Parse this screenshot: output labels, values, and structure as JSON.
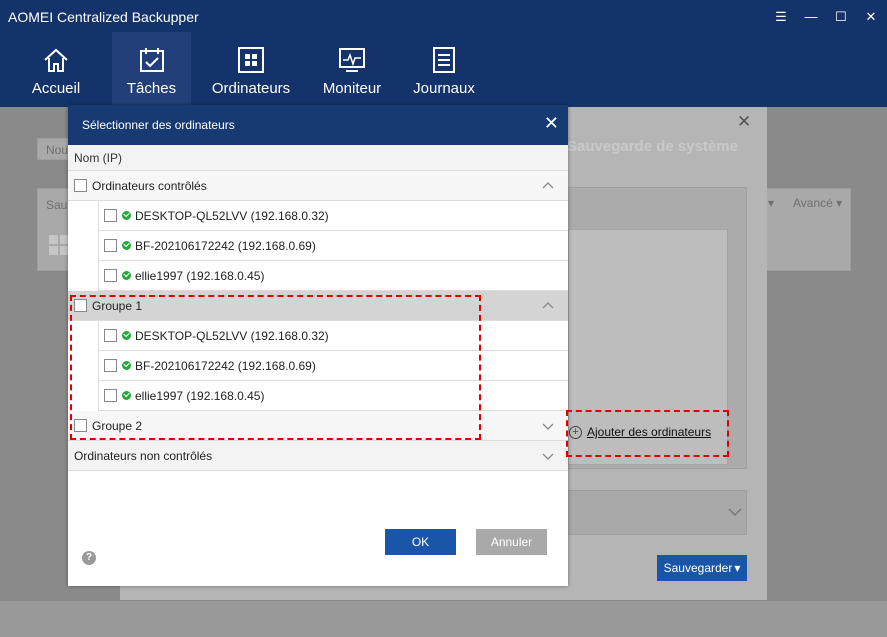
{
  "app": {
    "title": "AOMEI Centralized Backupper"
  },
  "nav": [
    {
      "label": "Accueil",
      "icon": "home-icon"
    },
    {
      "label": "Tâches",
      "icon": "tasks-icon"
    },
    {
      "label": "Ordinateurs",
      "icon": "computers-icon"
    },
    {
      "label": "Moniteur",
      "icon": "monitor-icon"
    },
    {
      "label": "Journaux",
      "icon": "logs-icon"
    }
  ],
  "background": {
    "heading": "Sauvegarde de système",
    "new_button": "Nou",
    "tab_left": "Sau",
    "advanced": "Avancé",
    "add_computers": "Ajouter des ordinateurs",
    "save_button": "Sauvegarder"
  },
  "dialog": {
    "title": "Sélectionner des ordinateurs",
    "column_header": "Nom (IP)",
    "groups": [
      {
        "label": "Ordinateurs contrôlés",
        "expanded": true,
        "computers": [
          "DESKTOP-QL52LVV (192.168.0.32)",
          "BF-202106172242 (192.168.0.69)",
          "ellie1997 (192.168.0.45)"
        ]
      },
      {
        "label": "Groupe 1",
        "expanded": true,
        "computers": [
          "DESKTOP-QL52LVV (192.168.0.32)",
          "BF-202106172242 (192.168.0.69)",
          "ellie1997 (192.168.0.45)"
        ]
      },
      {
        "label": "Groupe 2",
        "expanded": false,
        "computers": []
      },
      {
        "label": "Ordinateurs non contrôlés",
        "expanded": false,
        "computers": []
      }
    ],
    "ok_label": "OK",
    "cancel_label": "Annuler"
  },
  "colors": {
    "titlebar": "#14336a",
    "accent": "#1a56a8",
    "online_status": "#27a83a",
    "highlight_dash": "#e10000"
  }
}
